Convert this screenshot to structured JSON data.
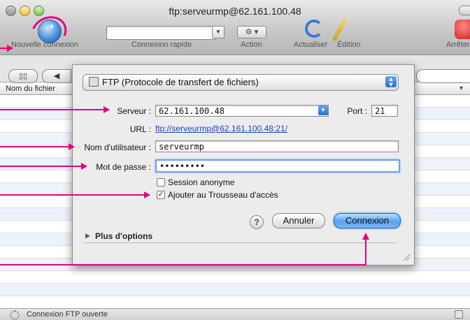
{
  "window": {
    "title": "ftp:serveurmp@62.161.100.48"
  },
  "toolbar": {
    "new_connection_label": "Nouvelle connexion",
    "quick_connect_label": "Connexion rapide",
    "action_label": "Action",
    "refresh_label": "Actualiser",
    "edit_label": "Édition",
    "stop_label": "Arrêter",
    "quick_connect_value": ""
  },
  "browser": {
    "column_header": "Nom du fichier"
  },
  "status": {
    "text": "Connexion FTP ouverte"
  },
  "dialog": {
    "protocol": "FTP (Protocole de transfert de fichiers)",
    "server_label": "Serveur :",
    "server_value": "62.161.100.48",
    "port_label": "Port :",
    "port_value": "21",
    "url_label": "URL :",
    "url_value": "ftp://serveurmp@62.161.100.48:21/",
    "username_label": "Nom d'utilisateur :",
    "username_value": "serveurmp",
    "password_label": "Mot de passe :",
    "password_value": "•••••••••",
    "anonymous_label": "Session anonyme",
    "anonymous_checked": false,
    "keychain_label": "Ajouter au Trousseau d'accès",
    "keychain_checked": true,
    "help_label": "?",
    "cancel_label": "Annuler",
    "connect_label": "Connexion",
    "more_options_label": "Plus d'options"
  },
  "colors": {
    "annotation": "#e6007e",
    "link": "#1f43c4",
    "focus_ring": "#6ea0ef"
  }
}
